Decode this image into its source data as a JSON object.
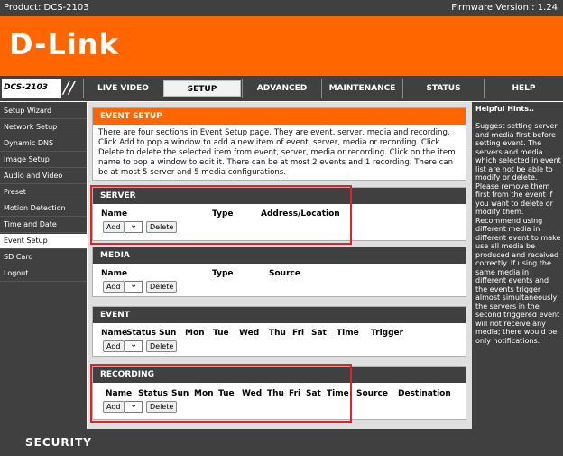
{
  "topbar": {
    "product": "Product: DCS-2103",
    "firmware": "Firmware Version : 1.24"
  },
  "brand": {
    "logo": "D-Link",
    "orange": "#ff6600",
    "dark": "#404040"
  },
  "nav": {
    "model": "DCS-2103",
    "tabs": [
      "LIVE VIDEO",
      "SETUP",
      "ADVANCED",
      "MAINTENANCE",
      "STATUS",
      "HELP"
    ],
    "active_tab": "SETUP"
  },
  "sidebar": {
    "items": [
      "Setup Wizard",
      "Network Setup",
      "Dynamic DNS",
      "Image Setup",
      "Audio and Video",
      "Preset",
      "Motion Detection",
      "Time and Date",
      "Event Setup",
      "SD Card",
      "Logout"
    ],
    "active": "Event Setup"
  },
  "event_setup": {
    "title": "EVENT SETUP",
    "description": "There are four sections in Event Setup page. They are event, server, media and recording. Click Add to pop a window to add a new item of event, server, media or recording. Click Delete to delete the selected item from event, server, media or recording. Click on the item name to pop a window to edit it. There can be at most 2 events and 1 recording. There can be at most 5 server and 5 media configurations."
  },
  "server": {
    "title": "SERVER",
    "columns": [
      "Name",
      "Type",
      "Address/Location"
    ]
  },
  "media": {
    "title": "MEDIA",
    "columns": [
      "Name",
      "Type",
      "Source"
    ]
  },
  "event": {
    "title": "EVENT",
    "columns": [
      "Name",
      "Status",
      "Sun",
      "Mon",
      "Tue",
      "Wed",
      "Thu",
      "Fri",
      "Sat",
      "Time",
      "Trigger"
    ]
  },
  "recording": {
    "title": "RECORDING",
    "columns": [
      "Name",
      "Status",
      "Sun",
      "Mon",
      "Tue",
      "Wed",
      "Thu",
      "Fri",
      "Sat",
      "Time",
      "Source",
      "Destination"
    ]
  },
  "buttons": {
    "add": "Add",
    "delete": "Delete",
    "select_glyph": "⌄"
  },
  "hints": {
    "title": "Helpful Hints..",
    "text": "Suggest setting server and media first before setting event. The servers and media which selected in event list are not be able to modify or delete. Please remove them first from the event if you want to delete or modify them. Recommend using different media in different event to make use all media be produced and received correctly. If using the same media in different events and the events trigger almost simultaneously, the servers in the second triggered event will not receive any media; there would be only notifications."
  },
  "footer": {
    "text": "SECURITY"
  }
}
